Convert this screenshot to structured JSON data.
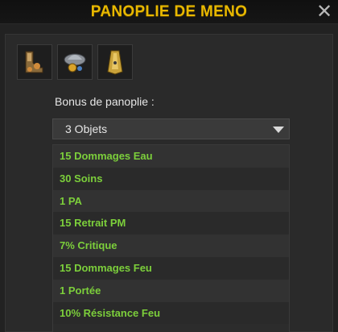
{
  "window": {
    "title": "PANOPLIE DE MENO",
    "close_label": "✕"
  },
  "items": [
    {
      "icon": "boots-item-icon"
    },
    {
      "icon": "hat-item-icon"
    },
    {
      "icon": "cape-item-icon"
    }
  ],
  "bonus": {
    "label": "Bonus de panoplie :",
    "selected": "3 Objets",
    "list": [
      "15 Dommages Eau",
      "30 Soins",
      "1 PA",
      "15 Retrait PM",
      "7% Critique",
      "15 Dommages Feu",
      "1 Portée",
      "10% Résistance Feu"
    ]
  },
  "colors": {
    "title": "#e8b800",
    "bonus_text": "#7ccf3b"
  }
}
